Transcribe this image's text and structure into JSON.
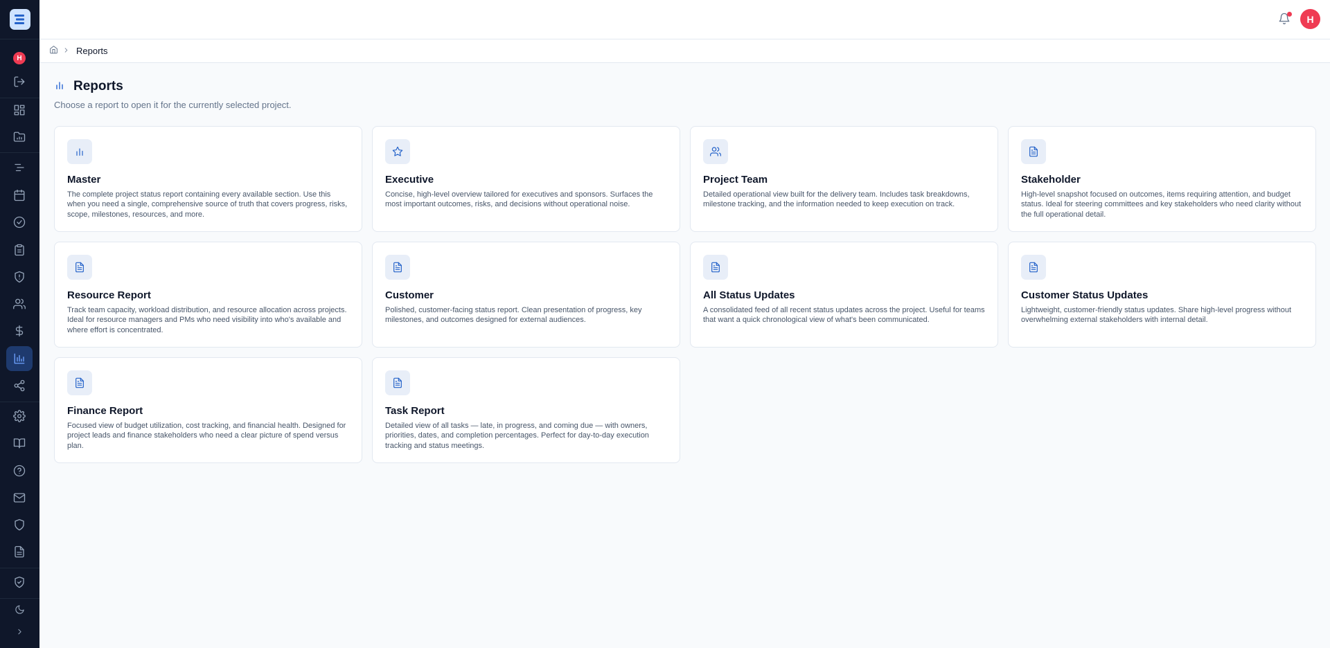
{
  "sidebar": {
    "logo": "logo-icon",
    "user_initial": "H",
    "items": [
      {
        "name": "logout",
        "icon": "logout-icon"
      },
      {
        "name": "dashboard",
        "icon": "dashboard-icon"
      },
      {
        "name": "portfolio",
        "icon": "folder-chart-icon"
      },
      {
        "name": "gantt",
        "icon": "gantt-icon"
      },
      {
        "name": "calendar",
        "icon": "calendar-icon"
      },
      {
        "name": "tasks",
        "icon": "check-circle-icon"
      },
      {
        "name": "clipboard",
        "icon": "clipboard-icon"
      },
      {
        "name": "risks",
        "icon": "shield-alert-icon"
      },
      {
        "name": "team",
        "icon": "users-icon"
      },
      {
        "name": "finance",
        "icon": "dollar-icon"
      },
      {
        "name": "reports",
        "icon": "bar-chart-icon",
        "active": true
      },
      {
        "name": "share",
        "icon": "share-icon"
      },
      {
        "name": "settings",
        "icon": "gear-icon"
      },
      {
        "name": "docs",
        "icon": "book-icon"
      },
      {
        "name": "help",
        "icon": "help-icon"
      },
      {
        "name": "mail",
        "icon": "mail-icon"
      },
      {
        "name": "security",
        "icon": "shield-icon"
      },
      {
        "name": "document",
        "icon": "file-icon"
      },
      {
        "name": "verified",
        "icon": "shield-check-icon"
      },
      {
        "name": "theme",
        "icon": "moon-icon"
      },
      {
        "name": "expand",
        "icon": "chevron-right-icon"
      }
    ]
  },
  "header": {
    "user_initial": "H",
    "notification_icon": "bell-icon"
  },
  "breadcrumb": {
    "home_icon": "home-icon",
    "current": "Reports"
  },
  "page": {
    "title": "Reports",
    "subtitle": "Choose a report to open it for the currently selected project."
  },
  "cards": [
    {
      "icon": "bar-chart-icon",
      "title": "Master",
      "desc": "The complete project status report containing every available section. Use this when you need a single, comprehensive source of truth that covers progress, risks, scope, milestones, resources, and more."
    },
    {
      "icon": "star-icon",
      "title": "Executive",
      "desc": "Concise, high-level overview tailored for executives and sponsors. Surfaces the most important outcomes, risks, and decisions without operational noise."
    },
    {
      "icon": "users-icon",
      "title": "Project Team",
      "desc": "Detailed operational view built for the delivery team. Includes task breakdowns, milestone tracking, and the information needed to keep execution on track."
    },
    {
      "icon": "file-text-icon",
      "title": "Stakeholder",
      "desc": "High-level snapshot focused on outcomes, items requiring attention, and budget status. Ideal for steering committees and key stakeholders who need clarity without the full operational detail."
    },
    {
      "icon": "file-text-icon",
      "title": "Resource Report",
      "desc": "Track team capacity, workload distribution, and resource allocation across projects. Ideal for resource managers and PMs who need visibility into who's available and where effort is concentrated."
    },
    {
      "icon": "file-text-icon",
      "title": "Customer",
      "desc": "Polished, customer-facing status report. Clean presentation of progress, key milestones, and outcomes designed for external audiences."
    },
    {
      "icon": "file-text-icon",
      "title": "All Status Updates",
      "desc": "A consolidated feed of all recent status updates across the project. Useful for teams that want a quick chronological view of what's been communicated."
    },
    {
      "icon": "file-text-icon",
      "title": "Customer Status Updates",
      "desc": "Lightweight, customer-friendly status updates. Share high-level progress without overwhelming external stakeholders with internal detail."
    },
    {
      "icon": "file-text-icon",
      "title": "Finance Report",
      "desc": "Focused view of budget utilization, cost tracking, and financial health. Designed for project leads and finance stakeholders who need a clear picture of spend versus plan."
    },
    {
      "icon": "file-text-icon",
      "title": "Task Report",
      "desc": "Detailed view of all tasks — late, in progress, and coming due — with owners, priorities, dates, and completion percentages. Perfect for day-to-day execution tracking and status meetings."
    }
  ]
}
